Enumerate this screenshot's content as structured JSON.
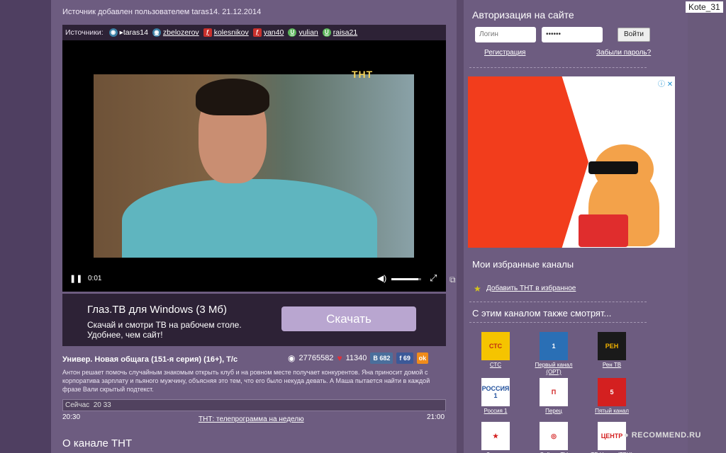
{
  "source_added_text": "Источник добавлен пользователем taras14. 21.12.2014",
  "sources": {
    "label": "Источники:",
    "items": [
      {
        "name": "▸taras14",
        "icon": "eye-icon"
      },
      {
        "name": "zbelozerov",
        "icon": "eye-icon"
      },
      {
        "name": "kolesnikov",
        "icon": "rutube-icon"
      },
      {
        "name": "yan40",
        "icon": "rutube-icon"
      },
      {
        "name": "yulian",
        "icon": "vk-icon"
      },
      {
        "name": "raisa21",
        "icon": "vk-icon"
      }
    ]
  },
  "player": {
    "channel_logo": "ТНТ",
    "time": "0:01",
    "volume_fraction": 0.9
  },
  "promo": {
    "title": "Глаз.ТВ для Windows (3 Мб)",
    "text": "Скачай и смотри ТВ на рабочем столе. Удобнее, чем сайт!",
    "button": "Скачать"
  },
  "show": {
    "title": "Универ. Новая общага (151-я серия) (16+), Т/с",
    "views": "27765582",
    "likes": "11340",
    "vk_label": "В",
    "vk_count": "682",
    "fb_label": "f",
    "fb_count": "69",
    "ok_label": "ok",
    "description": "Антон решает помочь случайным знакомым открыть клуб и на ровном месте получает конкурентов. Яна приносит домой с корпоратива зарплату и пьяного мужчину, объясняя это тем, что его было некуда девать. А Маша пытается найти в каждой фразе Вали скрытый подтекст.",
    "now_label": "Сейчас",
    "now_time": "20 33",
    "start_time": "20:30",
    "end_time": "21:00",
    "schedule_link": "ТНТ: телепрограмма на неделю",
    "about_title": "О канале ТНТ"
  },
  "auth": {
    "title": "Авторизация на сайте",
    "login_placeholder": "Логин",
    "password_value": "••••••",
    "login_button": "Войти",
    "register_link": "Регистрация",
    "forgot_link": "Забыли пароль?"
  },
  "ad": {
    "info_icon": "ⓘ ✕"
  },
  "favorites": {
    "title": "Мои избранные каналы",
    "add_link": "Добавить ТНТ в избранное"
  },
  "also_watch": {
    "title": "С этим каналом также смотрят...",
    "channels": [
      {
        "logo": "СТС",
        "name": "СТС",
        "color": "#f5c400",
        "fg": "#c03010"
      },
      {
        "logo": "1",
        "name": "Первый канал (ОРТ)",
        "color": "#2a6fb5",
        "fg": "#ffffff"
      },
      {
        "logo": "РЕН",
        "name": "Рен ТВ",
        "color": "#1a1a1a",
        "fg": "#f2b300"
      },
      {
        "logo": "РОССИЯ 1",
        "name": "Россия 1",
        "color": "#ffffff",
        "fg": "#1f4f9c"
      },
      {
        "logo": "П",
        "name": "Перец",
        "color": "#ffffff",
        "fg": "#d02020"
      },
      {
        "logo": "5",
        "name": "Пятый канал",
        "color": "#d42020",
        "fg": "#ffffff"
      },
      {
        "logo": "★",
        "name": "Звезда",
        "color": "#ffffff",
        "fg": "#d42020"
      },
      {
        "logo": "◎",
        "name": "College TV",
        "color": "#ffffff",
        "fg": "#d42020"
      },
      {
        "logo": "ЦЕНТР",
        "name": "ТВ Центр (ТВЦ)",
        "color": "#ffffff",
        "fg": "#d42020"
      }
    ]
  },
  "watermark": {
    "user": "Kote_31",
    "site": "● RECOMMEND.RU"
  }
}
